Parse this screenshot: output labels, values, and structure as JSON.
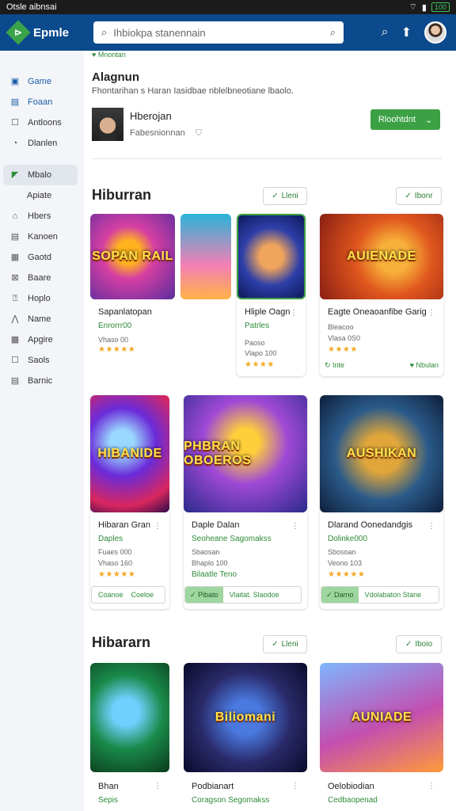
{
  "status": {
    "time": "Otsle aibnsai",
    "battery": "100"
  },
  "appbar": {
    "app_name": "Epmle",
    "search_placeholder": "Ihbiokpa stanennain",
    "search_icon": "search-icon",
    "actions": [
      "search-icon",
      "pin-icon",
      "avatar"
    ]
  },
  "sidebar": {
    "items": [
      {
        "label": "Game",
        "icon": "store-icon",
        "style": "blue"
      },
      {
        "label": "Foaan",
        "icon": "bookmark-icon",
        "style": "blue"
      },
      {
        "label": "Antloons",
        "icon": "list-icon",
        "style": "plain"
      },
      {
        "label": "Dlanlen",
        "icon": "download-icon",
        "style": "plain"
      }
    ],
    "active": {
      "label": "Mbalo",
      "icon": "play-icon"
    },
    "sub": "Apiate",
    "more": [
      {
        "label": "Hbers",
        "icon": "home-icon"
      },
      {
        "label": "Kanoen",
        "icon": "doc-icon"
      },
      {
        "label": "Gaotd",
        "icon": "grid-icon"
      },
      {
        "label": "Baare",
        "icon": "box-icon"
      },
      {
        "label": "Hoplo",
        "icon": "help-icon"
      },
      {
        "label": "Name",
        "icon": "chart-icon"
      },
      {
        "label": "Apgire",
        "icon": "calendar-icon"
      },
      {
        "label": "Saols",
        "icon": "tag-icon"
      },
      {
        "label": "Barnic",
        "icon": "list-icon"
      }
    ]
  },
  "hero": {
    "title": "Alagnun",
    "subtitle": "Fhontarihan s Haran Iasidbae nblelbneotiane lbaolo.",
    "profile_name": "Hberojan",
    "profile_meta": "Fabesnionnan",
    "install_label": "Rloohtdnt"
  },
  "sections": [
    {
      "title": "Hiburran",
      "chip_left": "Lleni",
      "chip_right": "Ibonr",
      "cards": [
        {
          "title": "Sapanlatopan",
          "cat": "Enrorrr00",
          "meta": "Vhaso 00",
          "stars": "★★★★★",
          "action": "Mnontan",
          "art": "SOPAN RAIL",
          "style": "a"
        },
        {
          "title": "Hliple Oagn",
          "cat": "Patrles",
          "meta": "Paoso",
          "meta2": "Vlapo 100",
          "stars": "★★★★",
          "action": "",
          "art": "",
          "style": "b"
        },
        {
          "title": "Eagte Oneaoanfibe Garig",
          "cat": "Bleacoo",
          "meta": "Vlasa 0S0",
          "stars": "★★★★",
          "action_left": "Inte",
          "action": "Nbulan",
          "art": "AUIENADE",
          "style": "c"
        }
      ]
    },
    {
      "cards": [
        {
          "title": "Hibaran Gran",
          "cat": "Daples",
          "meta": "Fuaes 000",
          "meta2": "Vhaso 160",
          "stars": "★★★★★",
          "btn_a": "Coanoe",
          "btn_b": "Coeloe",
          "art": "HIBANIDE",
          "style": "d"
        },
        {
          "title": "Daple Dalan",
          "cat": "Seoheane Sagomakss",
          "meta": "Sbaosan",
          "meta2": "Bhaplo 100",
          "stars": "Bilaatle Teno",
          "btn_a": "Pibato",
          "btn_b": "Vlaitat. Slaodoe",
          "art": "PHBRAN OBOEROS",
          "style": "e"
        },
        {
          "title": "Dlarand Oonedandgis",
          "cat": "Dolinke000",
          "meta": "Sbosoan",
          "meta2": "Veono 103",
          "stars": "★★★★★",
          "btn_a": "Darno",
          "btn_b": "Vdolabaton Stane",
          "art": "AUSHIKAN",
          "style": "f"
        }
      ]
    },
    {
      "title": "Hibararn",
      "chip_left": "Lleni",
      "chip_right": "Iboio",
      "cards": [
        {
          "title": "Bhan",
          "cat": "Sepis",
          "art": "",
          "style": "g"
        },
        {
          "title": "Podbianart",
          "cat": "Coragson Segomakss",
          "art": "Biliomani",
          "style": "h"
        },
        {
          "title": "Oelobiodian",
          "cat": "Cedbaopenad",
          "art": "AUNIADE",
          "style": "i"
        }
      ]
    }
  ],
  "colors": {
    "appbar": "#0b4a8c",
    "accent": "#3ca144",
    "star": "#f0a820"
  }
}
